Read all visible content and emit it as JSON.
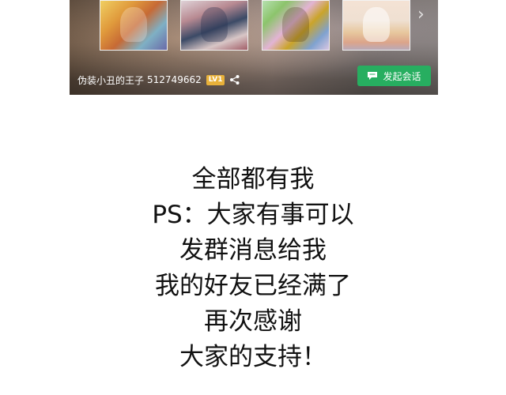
{
  "banner": {
    "username": "伪装小丑的王子",
    "user_id": "512749662",
    "level": "LV1",
    "chat_button_label": "发起会话",
    "icons": {
      "share": "share-icon",
      "chat": "chat-bubble-icon",
      "next": "chevron-right-icon"
    }
  },
  "message_lines": [
    "全部都有我",
    "PS：大家有事可以",
    "发群消息给我",
    "我的好友已经满了",
    "再次感谢",
    "大家的支持！"
  ],
  "colors": {
    "chat_button": "#27ae60",
    "level_badge": "#e8b13a",
    "text": "#111111"
  }
}
